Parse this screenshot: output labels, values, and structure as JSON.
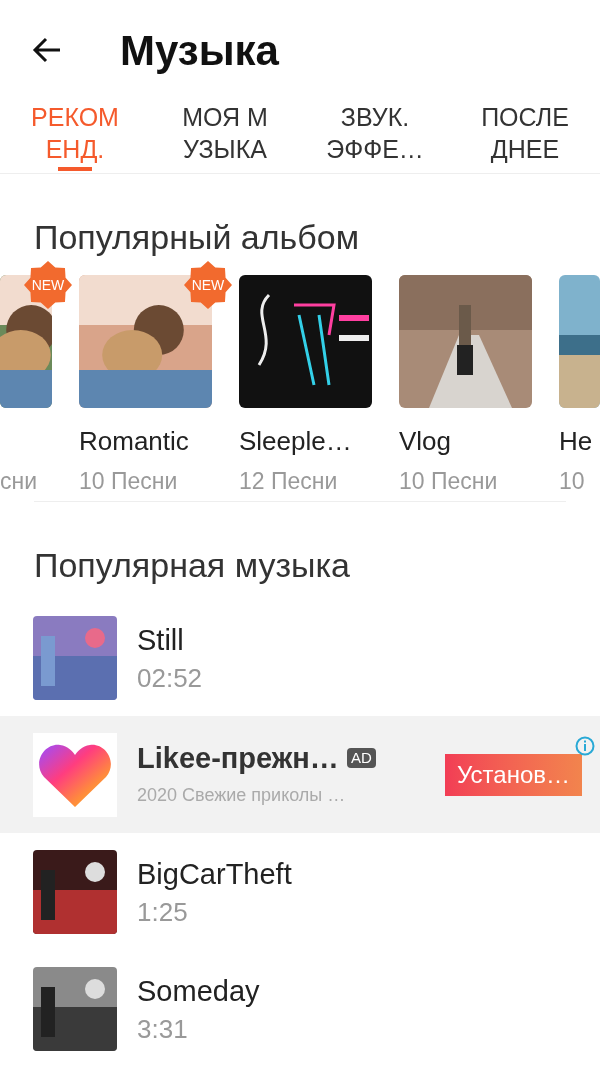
{
  "title": "Музыка",
  "tabs": [
    {
      "label": "РЕКОМ ЕНД.",
      "selected": true
    },
    {
      "label": "МОЯ М УЗЫКА",
      "selected": false
    },
    {
      "label": "ЗВУК. ЭФФЕ…",
      "selected": false
    },
    {
      "label": "ПОСЛЕ ДНЕЕ",
      "selected": false
    }
  ],
  "albums_heading": "Популярный альбом",
  "albums": [
    {
      "kind": "cut_left",
      "count": "сни",
      "badge": "NEW"
    },
    {
      "kind": "full",
      "name": "Romantic",
      "count": "10 Песни",
      "badge": "NEW"
    },
    {
      "kind": "full",
      "name": "Sleeple…",
      "count": "12 Песни"
    },
    {
      "kind": "full",
      "name": "Vlog",
      "count": "10 Песни"
    },
    {
      "kind": "cut_right",
      "name": "He",
      "count": "10"
    }
  ],
  "music_heading": "Популярная музыка",
  "songs": [
    {
      "kind": "song",
      "title": "Still",
      "duration": "02:52"
    },
    {
      "kind": "ad",
      "title": "Likee-прежн…",
      "badge": "AD",
      "subtitle": "2020 Свежие приколы …",
      "button": "Установ…"
    },
    {
      "kind": "song",
      "title": "BigCarTheft",
      "duration": "1:25"
    },
    {
      "kind": "song",
      "title": "Someday",
      "duration": "3:31"
    }
  ]
}
